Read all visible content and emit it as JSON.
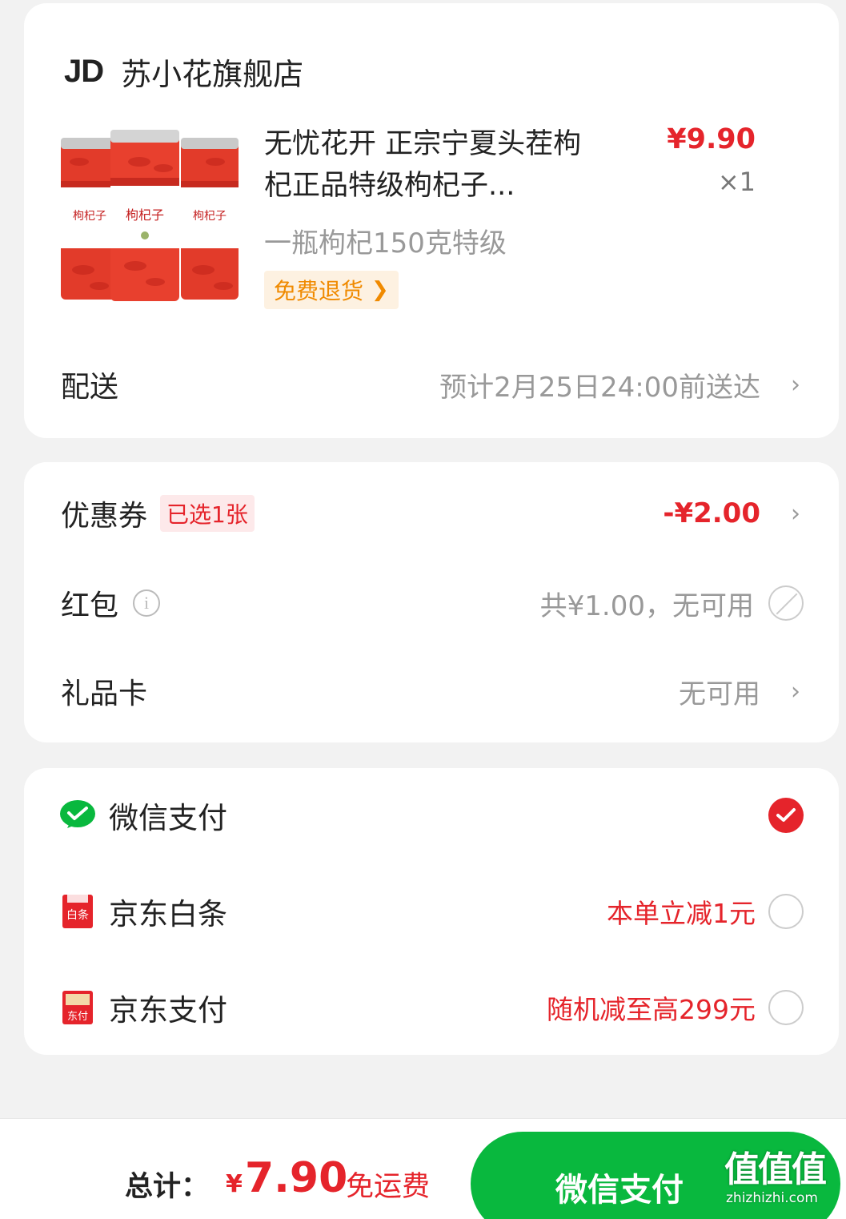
{
  "store": {
    "logo": "JD",
    "name": "苏小花旗舰店"
  },
  "product": {
    "image_label": "枸杞子",
    "title": "无忧花开 正宗宁夏头茬枸杞正品特级枸杞子...",
    "price": "¥9.90",
    "quantity": "×1",
    "spec": "一瓶枸杞150克特级",
    "return_badge": "免费退货"
  },
  "delivery": {
    "label": "配送",
    "value": "预计2月25日24:00前送达"
  },
  "coupon": {
    "label": "优惠券",
    "tag": "已选1张",
    "value": "-¥2.00"
  },
  "red_packet": {
    "label": "红包",
    "value": "共¥1.00，无可用"
  },
  "gift_card": {
    "label": "礼品卡",
    "value": "无可用"
  },
  "payment": {
    "methods": [
      {
        "label": "微信支付",
        "promo": "",
        "selected": true,
        "icon": "wechat-pay-icon"
      },
      {
        "label": "京东白条",
        "promo": "本单立减1元",
        "selected": false,
        "icon": "baitiao-icon"
      },
      {
        "label": "京东支付",
        "promo": "随机减至高299元",
        "selected": false,
        "icon": "jd-pay-icon"
      }
    ]
  },
  "footer": {
    "total_label": "总计：",
    "currency": "¥",
    "total_amount": "7.90",
    "shipping": "免运费",
    "pay_button": "微信支付"
  },
  "watermark": {
    "logo": "值值值",
    "url": "zhizhizhi.com"
  },
  "colors": {
    "accent_red": "#e5242b",
    "wechat_green": "#09b83e",
    "badge_orange": "#f08a00"
  }
}
